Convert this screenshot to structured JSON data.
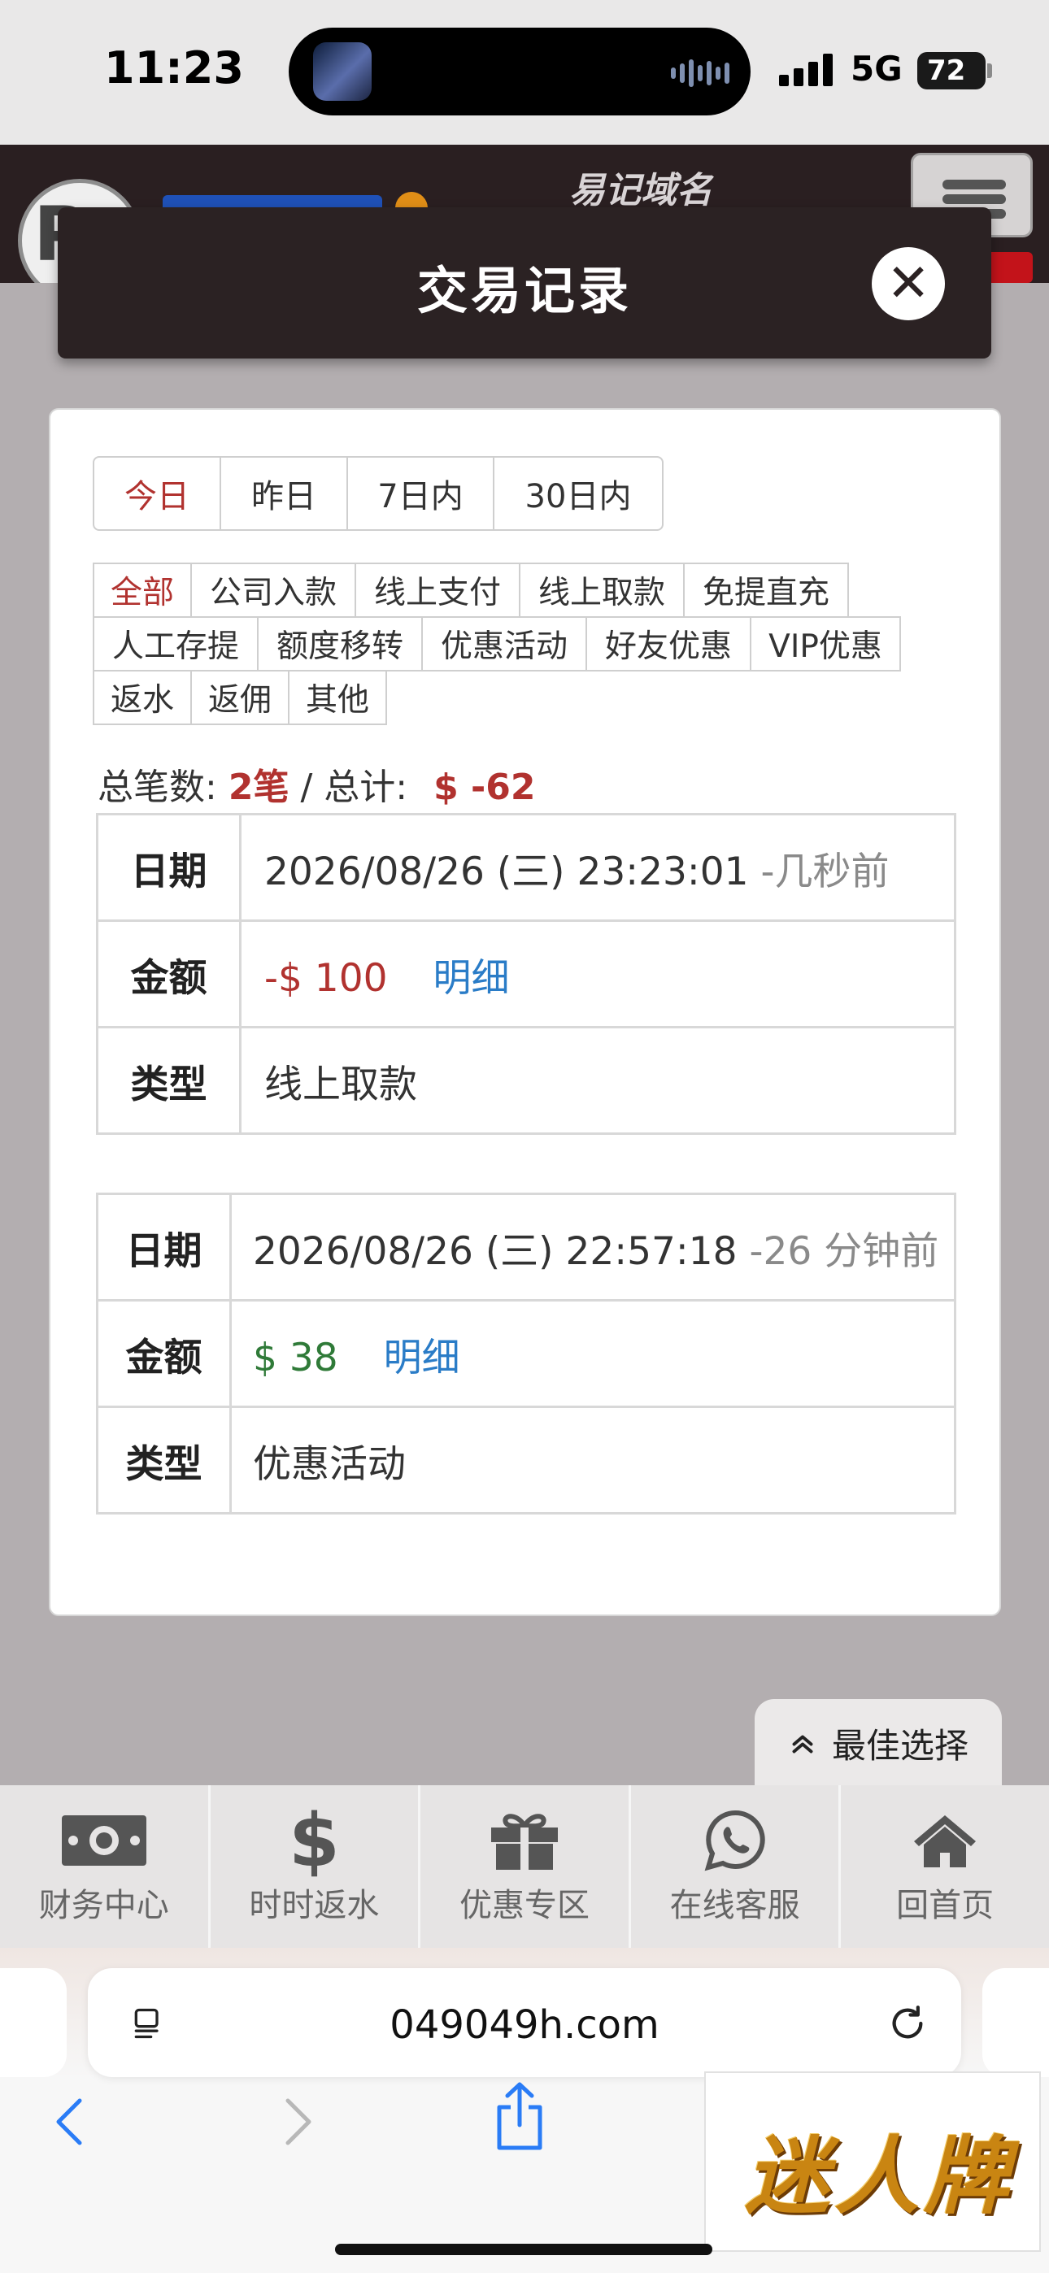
{
  "status_bar": {
    "time": "11:23",
    "network": "5G",
    "battery": "72"
  },
  "site": {
    "header_title": "易记域名"
  },
  "modal": {
    "title": "交易记录",
    "close_symbol": "✕"
  },
  "date_tabs": [
    {
      "label": "今日",
      "active": true
    },
    {
      "label": "昨日",
      "active": false
    },
    {
      "label": "7日内",
      "active": false
    },
    {
      "label": "30日内",
      "active": false
    }
  ],
  "filters": [
    [
      "全部",
      "公司入款",
      "线上支付",
      "线上取款",
      "免提直充"
    ],
    [
      "人工存提",
      "额度移转",
      "优惠活动",
      "好友优惠",
      "VIP优惠"
    ],
    [
      "返水",
      "返佣",
      "其他"
    ]
  ],
  "summary": {
    "count_label": "总笔数:",
    "count_value": "2笔",
    "sep": "/",
    "total_label": "总计:",
    "total_value": "$ -62"
  },
  "records": [
    {
      "date_label": "日期",
      "date": "2026/08/26 (三) 23:23:01",
      "ago": "-几秒前",
      "amount_label": "金额",
      "amount": "-$ 100",
      "amount_sign": "negative",
      "detail": "明细",
      "type_label": "类型",
      "type": "线上取款"
    },
    {
      "date_label": "日期",
      "date": "2026/08/26 (三) 22:57:18",
      "ago": "-26 分钟前",
      "amount_label": "金额",
      "amount": "$ 38",
      "amount_sign": "positive",
      "detail": "明细",
      "type_label": "类型",
      "type": "优惠活动"
    }
  ],
  "best_choice": {
    "label": "最佳选择",
    "icon": "double-chevron-up-icon"
  },
  "bottom_nav": [
    {
      "label": "财务中心",
      "icon": "money-icon"
    },
    {
      "label": "时时返水",
      "icon": "dollar-icon"
    },
    {
      "label": "优惠专区",
      "icon": "gift-icon"
    },
    {
      "label": "在线客服",
      "icon": "whatsapp-icon"
    },
    {
      "label": "回首页",
      "icon": "home-icon"
    }
  ],
  "browser": {
    "url": "049049h.com"
  },
  "ad": {
    "text": "迷人牌"
  },
  "colors": {
    "accent_red": "#b1322f",
    "positive_green": "#2f7a38",
    "link_blue": "#2a7cc7",
    "modal_header": "#2b2223"
  }
}
